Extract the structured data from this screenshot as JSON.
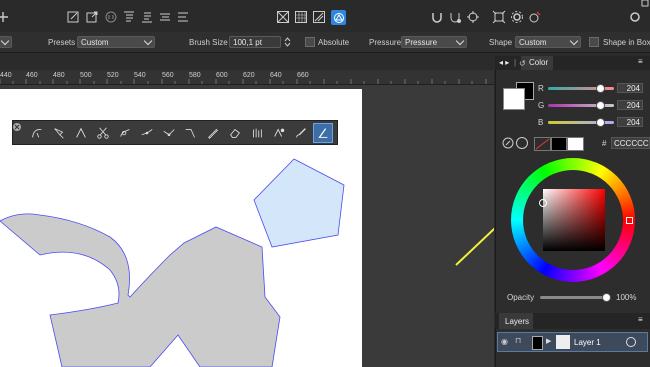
{
  "context_toolbar": {
    "presets_label": "Presets",
    "presets_value": "Custom",
    "brush_size_label": "Brush Size",
    "brush_size_value": "100,1 pt",
    "absolute_label": "Absolute",
    "pressure_label": "Pressure",
    "pressure_value": "Pressure",
    "shape_label": "Shape",
    "shape_value": "Custom",
    "shape_in_box_label": "Shape in Box"
  },
  "ruler": {
    "ticks": [
      "440",
      "460",
      "480",
      "500",
      "520",
      "540",
      "560",
      "580",
      "600",
      "620",
      "640",
      "660"
    ]
  },
  "color_panel": {
    "tab_label": "Color",
    "channels": [
      {
        "name": "R",
        "value": "204"
      },
      {
        "name": "G",
        "value": "204"
      },
      {
        "name": "B",
        "value": "204"
      }
    ],
    "hex_prefix": "#",
    "hex_value": "CCCCCC",
    "opacity_label": "Opacity",
    "opacity_value": "100%",
    "colors": {
      "fill": "#cccccc",
      "accent": "#3da2ff"
    }
  },
  "layers_panel": {
    "tab_label": "Layers",
    "layer_name": "Layer 1"
  }
}
